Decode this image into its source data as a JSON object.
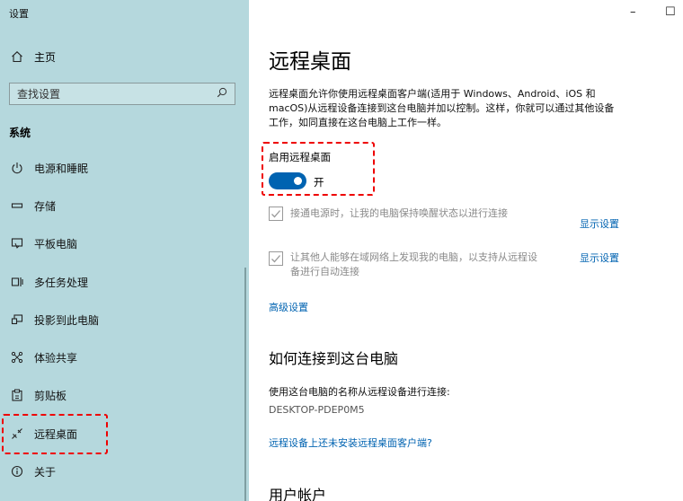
{
  "window": {
    "title": "设置",
    "minimize": "–",
    "maximize": "☐"
  },
  "sidebar": {
    "home_label": "主页",
    "search_placeholder": "查找设置",
    "section": "系统",
    "items": [
      {
        "label": "电源和睡眠",
        "icon": "power-icon"
      },
      {
        "label": "存储",
        "icon": "storage-icon"
      },
      {
        "label": "平板电脑",
        "icon": "tablet-icon"
      },
      {
        "label": "多任务处理",
        "icon": "multitasking-icon"
      },
      {
        "label": "投影到此电脑",
        "icon": "project-icon"
      },
      {
        "label": "体验共享",
        "icon": "share-icon"
      },
      {
        "label": "剪贴板",
        "icon": "clipboard-icon"
      },
      {
        "label": "远程桌面",
        "icon": "remote-desktop-icon",
        "selected": true
      },
      {
        "label": "关于",
        "icon": "info-icon"
      }
    ]
  },
  "main": {
    "title": "远程桌面",
    "description": "远程桌面允许你使用远程桌面客户端(适用于 Windows、Android、iOS 和 macOS)从远程设备连接到这台电脑并加以控制。这样，你就可以通过其他设备工作，如同直接在这台电脑上工作一样。",
    "enable_label": "启用远程桌面",
    "toggle_state": "开",
    "checkbox1": "接通电源时，让我的电脑保持唤醒状态以进行连接",
    "checkbox1_link": "显示设置",
    "checkbox2_line1": "让其他人能够在域网络上发现我的电脑，以支持从远程设",
    "checkbox2_line2": "备进行自动连接",
    "checkbox2_link": "显示设置",
    "advanced_link": "高级设置",
    "how_heading": "如何连接到这台电脑",
    "how_text": "使用这台电脑的名称从远程设备进行连接:",
    "pc_name": "DESKTOP-PDEP0M5",
    "client_link": "远程设备上还未安装远程桌面客户端?",
    "accounts_heading": "用户帐户"
  },
  "colors": {
    "accent": "#0063b1",
    "sidebar_bg": "#b5d8dd",
    "highlight": "#e00000"
  }
}
